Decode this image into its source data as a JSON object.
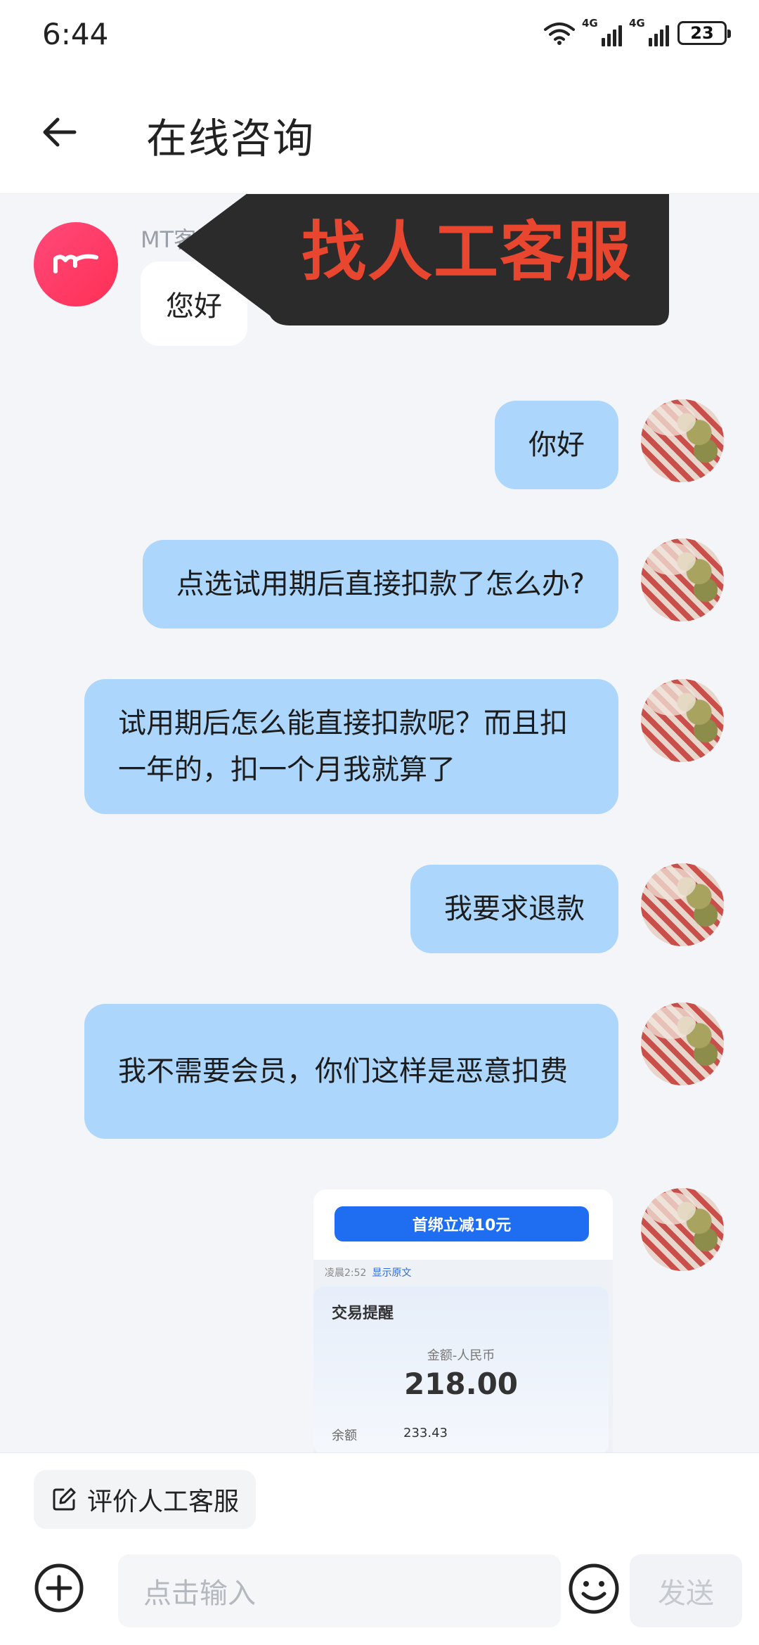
{
  "status_bar": {
    "time": "6:44",
    "network_1": "4G",
    "network_2": "4G",
    "battery": "23"
  },
  "header": {
    "title": "在线咨询"
  },
  "agent": {
    "name": "MT客服君",
    "greeting": "您好"
  },
  "overlay": {
    "text": "找人工客服",
    "colors": {
      "background": "#2b2b2b",
      "text": "#e8462f"
    }
  },
  "messages": [
    {
      "text": "你好"
    },
    {
      "text": "点选试用期后直接扣款了怎么办?"
    },
    {
      "text": "试用期后怎么能直接扣款呢？而且扣一年的，扣一个月我就算了"
    },
    {
      "text": "我要求退款"
    },
    {
      "text": "我不需要会员，你们这样是恶意扣费"
    }
  ],
  "image_message": {
    "banner_button": "首绑立减10元",
    "sub_text": "凌晨2:52",
    "sub_link": "显示原文",
    "card_title": "交易提醒",
    "amount_label": "金额-人民币",
    "amount": "218.00",
    "balance_label": "余额",
    "balance": "233.43"
  },
  "bottom": {
    "evaluate_label": "评价人工客服",
    "input_placeholder": "点击输入",
    "send_label": "发送"
  },
  "colors": {
    "user_bubble": "#acd6fb",
    "chat_background": "#f3f5f8",
    "agent_avatar": "#ff3d66"
  }
}
